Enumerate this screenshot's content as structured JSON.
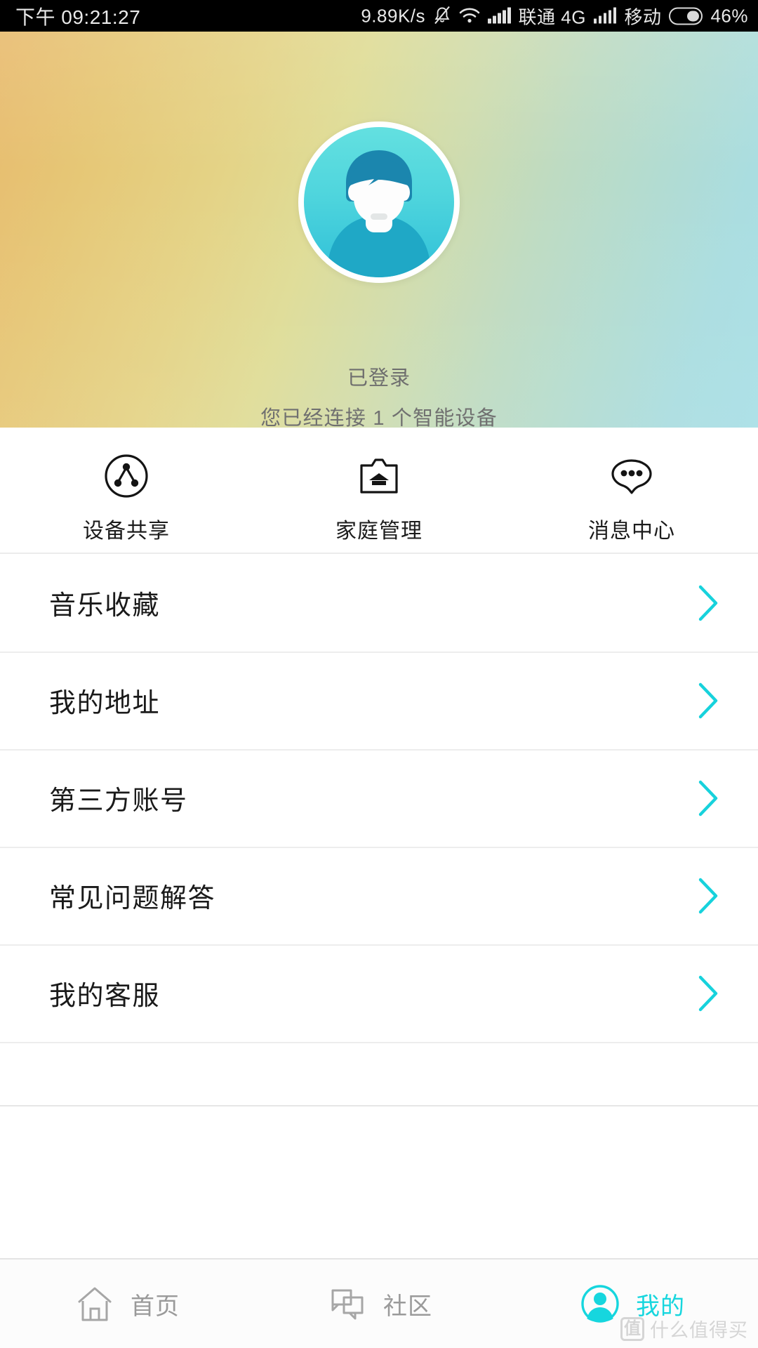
{
  "status_bar": {
    "time": "下午 09:21:27",
    "network_speed": "9.89K/s",
    "mute_icon": "bell-muted-icon",
    "wifi_icon": "wifi-icon",
    "signal1_icon": "signal-bars-icon",
    "carrier1": "联通 4G",
    "signal2_icon": "signal-bars-icon",
    "carrier2": "移动",
    "battery_icon": "battery-icon",
    "battery_percent": "46%"
  },
  "header": {
    "avatar_icon": "user-avatar-icon",
    "login_state": "已登录",
    "device_summary": "您已经连接 1 个智能设备"
  },
  "quick_actions": [
    {
      "icon": "share-network-icon",
      "label": "设备共享"
    },
    {
      "icon": "home-folder-icon",
      "label": "家庭管理"
    },
    {
      "icon": "message-bubble-icon",
      "label": "消息中心"
    }
  ],
  "menu_items": [
    {
      "label": "音乐收藏",
      "chevron": "chevron-right-icon"
    },
    {
      "label": "我的地址",
      "chevron": "chevron-right-icon"
    },
    {
      "label": "第三方账号",
      "chevron": "chevron-right-icon"
    },
    {
      "label": "常见问题解答",
      "chevron": "chevron-right-icon"
    },
    {
      "label": "我的客服",
      "chevron": "chevron-right-icon"
    }
  ],
  "tabbar": {
    "items": [
      {
        "icon": "home-icon",
        "label": "首页",
        "active": false
      },
      {
        "icon": "chat-icon",
        "label": "社区",
        "active": false
      },
      {
        "icon": "profile-icon",
        "label": "我的",
        "active": true
      }
    ]
  },
  "watermark": {
    "badge": "值",
    "text": "什么值得买"
  },
  "colors": {
    "accent": "#16d6de",
    "chevron": "#17d2dc",
    "text_primary": "#1a1a1a",
    "text_muted": "#6e6e6e",
    "tab_inactive": "#9a9a9a",
    "divider": "#ededed",
    "header_gradient_start": "#e8bb6e",
    "header_gradient_end": "#a8dfe6",
    "avatar_bg_start": "#63e0e0",
    "avatar_bg_end": "#2fc0d8"
  }
}
